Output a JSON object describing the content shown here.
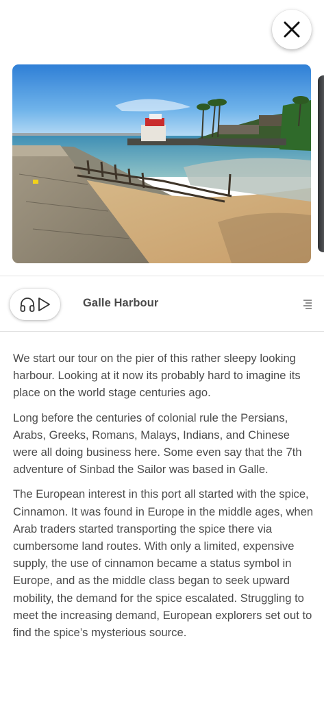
{
  "header": {
    "close_icon": "close-icon"
  },
  "gallery": {
    "current_photo": "Galle Harbour pier and beach with shipwreck",
    "has_next_photo": true
  },
  "player": {
    "headphones_icon": "headphones-icon",
    "play_icon": "play-icon",
    "title": "Galle Harbour",
    "menu_icon": "text-align-right-icon"
  },
  "article": {
    "paragraphs": [
      "We start our tour on the pier of this rather sleepy looking harbour. Looking at it now its probably hard to imagine its place on the world stage centuries ago.",
      "Long before the centuries of colonial rule the Persians, Arabs, Greeks, Romans, Malays, Indians, and Chinese were all doing business here. Some even say that the 7th adventure of Sinbad the Sailor was based in Galle.",
      "The European interest in this port all started with the spice, Cinnamon. It was found in Europe in the middle ages, when Arab traders started transporting the spice there via cumbersome land routes. With only a limited, expensive supply, the use of cinnamon became a status symbol in Europe, and as the middle class began to seek upward mobility, the demand for the spice escalated. Struggling to meet the increasing demand, European explorers set out to find the spice’s mysterious source."
    ]
  },
  "colors": {
    "text": "#4b4b4b",
    "divider": "#e2e2e2",
    "background": "#ffffff"
  }
}
